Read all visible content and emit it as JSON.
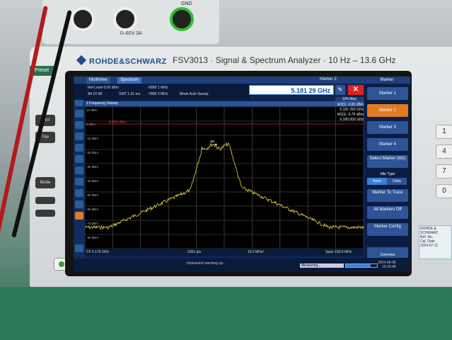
{
  "device": {
    "brand": "ROHDE&SCHWARZ",
    "model_title": "FSV3013 · Signal & Spectrum Analyzer · 10 Hz – 13.6 GHz",
    "preset_label": "Preset",
    "left_buttons": [
      "Print",
      "File",
      "Mode"
    ],
    "right_keypad": [
      "1",
      "4",
      "7",
      "0"
    ],
    "psu_label": "0–60V 3A",
    "psu_gnd": "GND",
    "sticker_lines": [
      "ROHDE & SCHWARZ",
      "Ref. No.",
      "Cal. Date",
      "2024-07-11"
    ]
  },
  "screen": {
    "tabs": [
      "MultiView",
      "Spectrum"
    ],
    "marker_panel_title": "Marker 2",
    "marker_header": "Marker",
    "params": {
      "ref_level": "Ref Level 0.00 dBm",
      "att": "Att 10 dB",
      "swt": "SWT 1.01 ms",
      "rbw": "RBW 1 MHz",
      "vbw": "VBW 3 MHz",
      "mode": "Mode Auto Sweep"
    },
    "marker_freq_value": "5.181 29 GHz",
    "trace_mode": "1Pk Max",
    "sweep_title": "1 Frequency Sweep",
    "marker_readout": [
      "M2[1]   -2.82 dBm",
      "5.181 290 GHz",
      "M1[1]   -5.79 dBm",
      "5.180 000 GHz"
    ],
    "ref_line_label": "0.000 dBm",
    "y_ticks": [
      "10 dBm",
      "0 dBm",
      "-10 dBm",
      "-20 dBm",
      "-30 dBm",
      "-40 dBm",
      "-50 dBm",
      "-60 dBm",
      "-70 dBm",
      "-80 dBm"
    ],
    "footer": {
      "cf": "CF 5.175 GHz",
      "points": "1001 pts",
      "per_div": "15.0 MHz/",
      "span": "Span 150.0 MHz"
    },
    "status": {
      "message": "Instrument warming up...",
      "measuring": "Measuring...",
      "progress": 0.8,
      "date": "2024-09-06",
      "time": "16:19:48"
    },
    "side_buttons": [
      "Marker 1",
      "Marker 2",
      "Marker 3",
      "Marker 4",
      "Select Marker (M2)",
      "Mkr Type",
      "Marker To Trace",
      "All Markers Off",
      "Marker Config"
    ],
    "mkr_type_options": [
      "Norm",
      "Delta"
    ],
    "overview_label": "Overview"
  }
}
